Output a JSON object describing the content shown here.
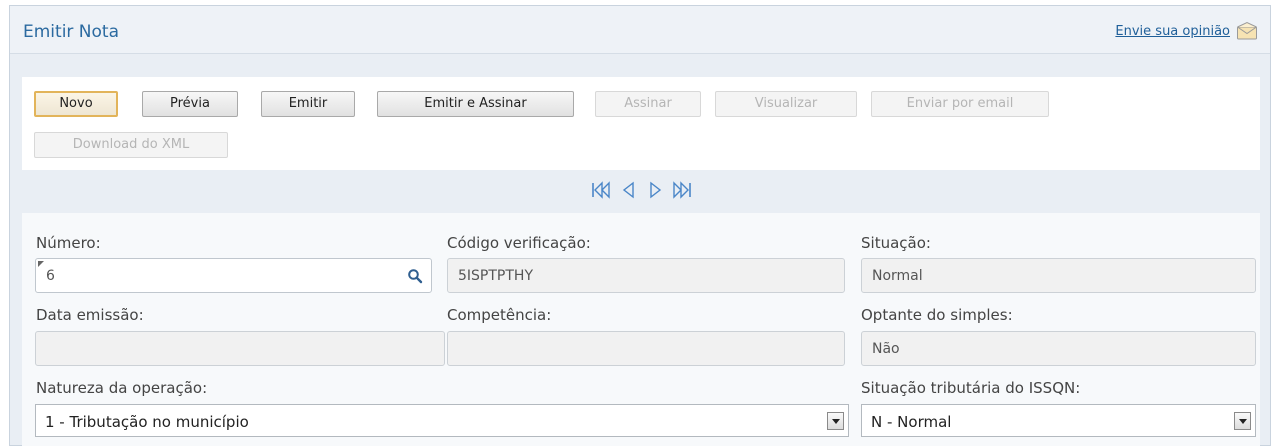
{
  "header": {
    "title": "Emitir Nota",
    "feedback_label": "Envie sua opinião",
    "feedback_icon": "mail-icon"
  },
  "toolbar": {
    "buttons": [
      {
        "label": "Novo",
        "state": "focused"
      },
      {
        "label": "Prévia",
        "state": "enabled"
      },
      {
        "label": "Emitir",
        "state": "enabled"
      },
      {
        "label": "Emitir e Assinar",
        "state": "enabled"
      },
      {
        "label": "Assinar",
        "state": "disabled"
      },
      {
        "label": "Visualizar",
        "state": "disabled"
      },
      {
        "label": "Enviar por email",
        "state": "disabled"
      },
      {
        "label": "Download do XML",
        "state": "disabled"
      }
    ]
  },
  "pager": {
    "icons": [
      "first-page-icon",
      "previous-page-icon",
      "next-page-icon",
      "last-page-icon"
    ],
    "color": "#4a86c8"
  },
  "form": {
    "numero": {
      "label": "Número:",
      "value": "6",
      "icon": "search-icon"
    },
    "codigo": {
      "label": "Código verificação:",
      "value": "5ISPTPTHY"
    },
    "situacao": {
      "label": "Situação:",
      "value": "Normal"
    },
    "data_emissao": {
      "label": "Data emissão:",
      "value": ""
    },
    "competencia": {
      "label": "Competência:",
      "value": ""
    },
    "optante": {
      "label": "Optante do simples:",
      "value": "Não"
    },
    "natureza": {
      "label": "Natureza da operação:",
      "value": "1 - Tributação no município"
    },
    "situacao_trib": {
      "label": "Situação tributária do ISSQN:",
      "value": "N - Normal"
    }
  },
  "colors": {
    "title": "#2b6aa0",
    "link": "#1f5f99",
    "focus_border": "#e2b45a"
  }
}
